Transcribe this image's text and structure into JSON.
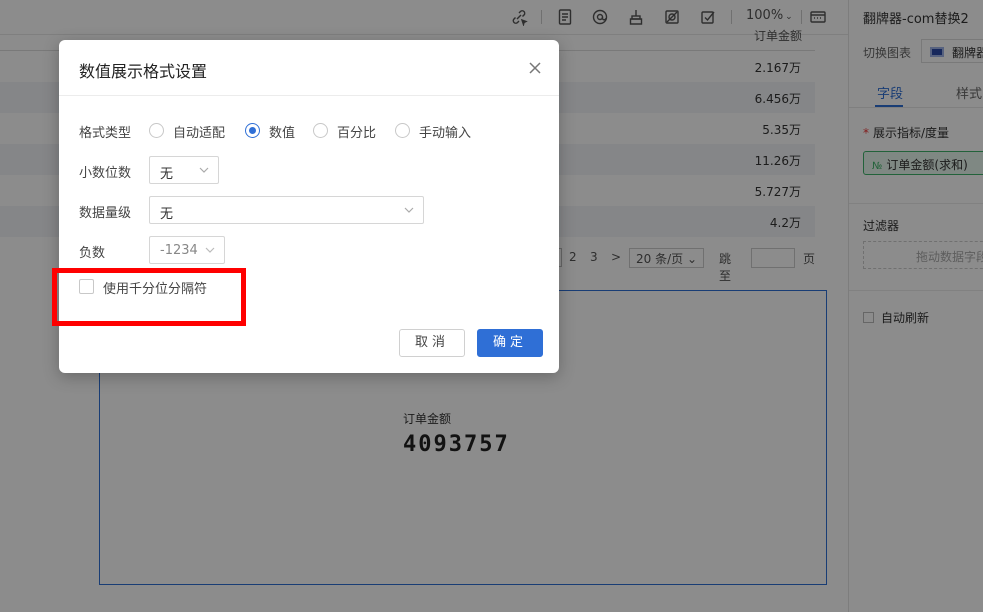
{
  "toolbar": {
    "zoom_label": "100%",
    "icons": [
      "link-cursor-icon",
      "document-icon",
      "at-sign-icon",
      "broom-icon",
      "no-view-icon",
      "checkbox-icon",
      "keyboard-icon"
    ]
  },
  "table": {
    "header": "订单金额",
    "rows": [
      "2.167万",
      "6.456万",
      "5.35万",
      "11.26万",
      "5.727万",
      "4.2万"
    ]
  },
  "pager": {
    "page2": "2",
    "page3": "3",
    "next_glyph": ">",
    "page_size": "20 条/页",
    "jump_label": "跳至",
    "page_unit": "页"
  },
  "widget": {
    "metric_label": "订单金额",
    "metric_value": "4093757"
  },
  "right_panel": {
    "title": "翻牌器-com替换2",
    "switch_label": "切换图表",
    "chart_name": "翻牌器",
    "tab_fields": "字段",
    "tab_style": "样式",
    "measure_label": "展示指标/度量",
    "measure_pill_prefix": "№",
    "measure_pill": "订单金额(求和)",
    "filter_label": "过滤器",
    "filter_drop": "拖动数据字段",
    "auto_refresh": "自动刷新"
  },
  "modal": {
    "title": "数值展示格式设置",
    "format_type_label": "格式类型",
    "format_options": [
      "自动适配",
      "数值",
      "百分比",
      "手动输入"
    ],
    "format_selected": "数值",
    "decimal_label": "小数位数",
    "decimal_value": "无",
    "magnitude_label": "数据量级",
    "magnitude_value": "无",
    "negative_label": "负数",
    "negative_value": "-1234",
    "thousands_label": "使用千分位分隔符",
    "thousands_checked": false,
    "cancel_label": "取消",
    "ok_label": "确定"
  },
  "colors": {
    "primary": "#2f6fd6",
    "highlight": "#ff0000",
    "overlay": "rgba(0,0,0,0.45)"
  }
}
